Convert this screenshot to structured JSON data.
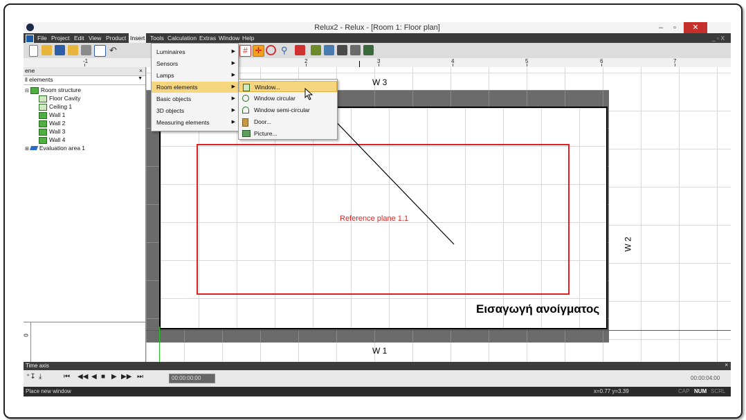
{
  "window": {
    "title": "Relux2 - Relux - [Room 1: Floor plan]",
    "minimize": "–",
    "restore": "▫",
    "close": "✕",
    "mdi_controls": "_ ▫ X"
  },
  "menubar": {
    "items": [
      "File",
      "Project",
      "Edit",
      "View",
      "Product",
      "Insert",
      "Tools",
      "Calculation",
      "Extras",
      "Window",
      "Help"
    ],
    "active": "Insert"
  },
  "insert_menu": {
    "items": [
      {
        "label": "Luminaires",
        "has_submenu": true
      },
      {
        "label": "Sensors",
        "has_submenu": true
      },
      {
        "label": "Lamps",
        "has_submenu": true
      },
      {
        "label": "Room elements",
        "has_submenu": true,
        "highlighted": true
      },
      {
        "label": "Basic objects",
        "has_submenu": true
      },
      {
        "label": "3D objects",
        "has_submenu": true
      },
      {
        "label": "Measuring elements",
        "has_submenu": true
      }
    ]
  },
  "room_elements_submenu": {
    "items": [
      {
        "label": "Window...",
        "icon": "window-icon",
        "highlighted": true
      },
      {
        "label": "Window circular",
        "icon": "window-circular-icon"
      },
      {
        "label": "Window semi-circular",
        "icon": "window-semicircular-icon"
      },
      {
        "label": "Door...",
        "icon": "door-icon"
      },
      {
        "label": "Picture...",
        "icon": "picture-icon"
      }
    ]
  },
  "ruler": {
    "labels": [
      "-1",
      "2",
      "3",
      "4",
      "5",
      "6",
      "7"
    ]
  },
  "scene_panel": {
    "header": "ene",
    "close": "×",
    "filter_value": "ll elements",
    "tree": [
      {
        "label": "Room structure",
        "level": 0
      },
      {
        "label": "Floor Cavity",
        "level": 1
      },
      {
        "label": "Ceiling 1",
        "level": 1
      },
      {
        "label": "Wall 1",
        "level": 1
      },
      {
        "label": "Wall 2",
        "level": 1
      },
      {
        "label": "Wall 3",
        "level": 1
      },
      {
        "label": "Wall 4",
        "level": 1
      },
      {
        "label": "Evaluation area 1",
        "level": 0
      }
    ]
  },
  "floorplan": {
    "wall_top": "W 3",
    "wall_right": "W 2",
    "wall_bottom": "W 1",
    "reference_plane": "Reference plane 1.1",
    "callout": "Εισαγωγή ανοίγματος"
  },
  "time_axis": {
    "label": "Time axis",
    "close": "×",
    "current": "00:00:00:00",
    "end": "00:00:04:00"
  },
  "statusbar": {
    "message": "Place new window",
    "coords": "x=0.77 y=3.39",
    "indicators": [
      "CAP",
      "NUM",
      "SCRL"
    ]
  },
  "colors": {
    "accent_highlight": "#f6d57f",
    "reference_plane": "#e02020",
    "close_button": "#c7302a"
  }
}
